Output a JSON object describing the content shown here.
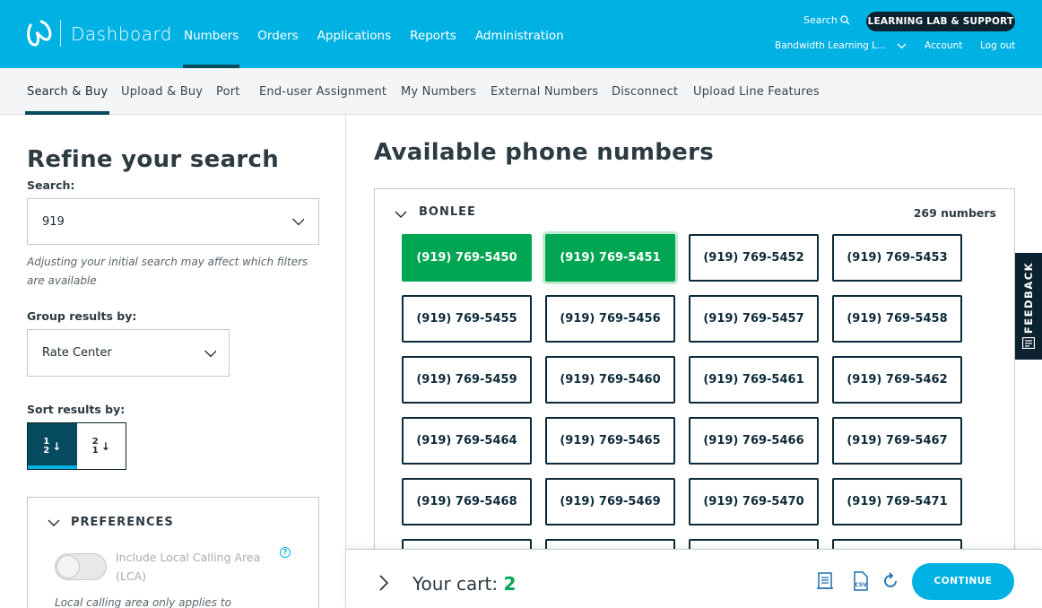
{
  "header": {
    "brand": "Dashboard",
    "nav": [
      {
        "label": "Numbers",
        "active": true
      },
      {
        "label": "Orders",
        "active": false
      },
      {
        "label": "Applications",
        "active": false
      },
      {
        "label": "Reports",
        "active": false
      },
      {
        "label": "Administration",
        "active": false
      }
    ],
    "search_label": "Search",
    "learning_lab_label": "LEARNING LAB & SUPPORT",
    "account_name": "Bandwidth Learning L...",
    "account_label": "Account",
    "logout_label": "Log out",
    "icons": [
      "bandwidth-logo",
      "search-icon",
      "chevron-down-icon"
    ]
  },
  "subnav": {
    "tabs": [
      {
        "label": "Search & Buy",
        "active": true
      },
      {
        "label": "Upload & Buy",
        "active": false
      },
      {
        "label": "Port",
        "active": false
      },
      {
        "label": "End-user Assignment",
        "active": false
      },
      {
        "label": "My Numbers",
        "active": false
      },
      {
        "label": "External Numbers",
        "active": false
      },
      {
        "label": "Disconnect",
        "active": false
      },
      {
        "label": "Upload Line Features",
        "active": false
      }
    ]
  },
  "refine": {
    "title": "Refine your search",
    "search_label": "Search:",
    "search_value": "919",
    "search_hint": "Adjusting your initial search may affect which filters are available",
    "group_label": "Group results by:",
    "group_value": "Rate Center",
    "sort_label": "Sort results by:",
    "sort_asc": {
      "top": "1",
      "bottom": "2",
      "arrow": "↓",
      "active": true
    },
    "sort_desc": {
      "top": "2",
      "bottom": "1",
      "arrow": "↓",
      "active": false
    },
    "preferences": {
      "heading": "PREFERENCES",
      "lca_label": "Include Local Calling Area (LCA)",
      "lca_enabled": false,
      "help_glyph": "?",
      "lca_note": "Local calling area only applies to"
    }
  },
  "results": {
    "title": "Available phone numbers",
    "group_name": "BONLEE",
    "group_count": "269 numbers",
    "numbers": [
      {
        "number": "(919) 769-5450",
        "selected": true
      },
      {
        "number": "(919) 769-5451",
        "selected": true
      },
      {
        "number": "(919) 769-5452",
        "selected": false
      },
      {
        "number": "(919) 769-5453",
        "selected": false
      },
      {
        "number": "(919) 769-5455",
        "selected": false
      },
      {
        "number": "(919) 769-5456",
        "selected": false
      },
      {
        "number": "(919) 769-5457",
        "selected": false
      },
      {
        "number": "(919) 769-5458",
        "selected": false
      },
      {
        "number": "(919) 769-5459",
        "selected": false
      },
      {
        "number": "(919) 769-5460",
        "selected": false
      },
      {
        "number": "(919) 769-5461",
        "selected": false
      },
      {
        "number": "(919) 769-5462",
        "selected": false
      },
      {
        "number": "(919) 769-5464",
        "selected": false
      },
      {
        "number": "(919) 769-5465",
        "selected": false
      },
      {
        "number": "(919) 769-5466",
        "selected": false
      },
      {
        "number": "(919) 769-5467",
        "selected": false
      },
      {
        "number": "(919) 769-5468",
        "selected": false
      },
      {
        "number": "(919) 769-5469",
        "selected": false
      },
      {
        "number": "(919) 769-5470",
        "selected": false
      },
      {
        "number": "(919) 769-5471",
        "selected": false
      }
    ]
  },
  "feedback": {
    "label": "FEEDBACK"
  },
  "cart": {
    "label": "Your cart:",
    "count": "2",
    "continue_label": "CONTINUE",
    "icons": [
      "receipt-icon",
      "csv-file-icon",
      "refresh-icon"
    ]
  },
  "colors": {
    "brand_blue": "#00b2e3",
    "dark_navy": "#0d2230",
    "selected_green": "#00a651",
    "active_underline": "#054a5e"
  }
}
